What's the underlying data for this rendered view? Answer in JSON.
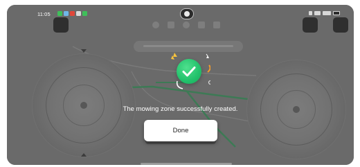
{
  "status_bar": {
    "time": "11:05",
    "notification_icons": [
      "messages-icon",
      "maps-icon",
      "email-icon",
      "app-icon",
      "chat-icon"
    ],
    "system_icons": [
      "bluetooth-icon",
      "wifi-icon",
      "signal-icon",
      "battery-icon"
    ]
  },
  "dialog": {
    "message": "The mowing zone successfully created.",
    "done_label": "Done",
    "accent_color": "#22c16b"
  },
  "colors": {
    "overlay": "#5c5c5c",
    "path_green": "#2e8b57",
    "confetti_yellow": "#f6c23e",
    "confetti_orange": "#f39c2c"
  }
}
